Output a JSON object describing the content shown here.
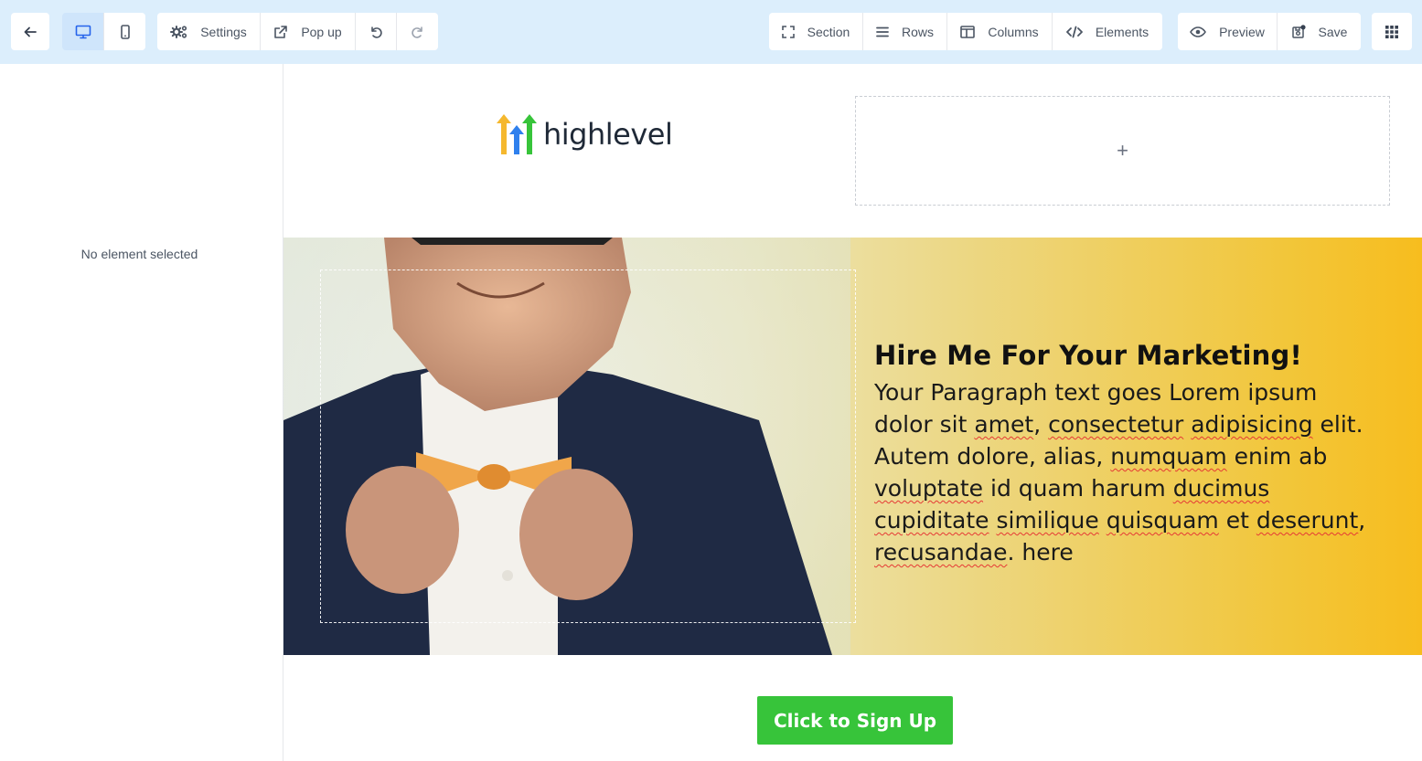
{
  "toolbar": {
    "settings_label": "Settings",
    "popup_label": "Pop up",
    "section_label": "Section",
    "rows_label": "Rows",
    "columns_label": "Columns",
    "elements_label": "Elements",
    "preview_label": "Preview",
    "save_label": "Save"
  },
  "left_panel": {
    "empty_message": "No element selected"
  },
  "canvas": {
    "logo_text": "highlevel",
    "add_placeholder": "+",
    "headline": "Hire Me For Your Marketing!",
    "paragraph": [
      {
        "t": "Your Paragraph text goes Lorem ipsum dolor sit ",
        "u": false
      },
      {
        "t": "amet",
        "u": true
      },
      {
        "t": ", ",
        "u": false
      },
      {
        "t": "consectetur",
        "u": true
      },
      {
        "t": " ",
        "u": false
      },
      {
        "t": "adipisicing",
        "u": true
      },
      {
        "t": " elit. Autem dolore, alias, ",
        "u": false
      },
      {
        "t": "numquam",
        "u": true
      },
      {
        "t": " enim ab ",
        "u": false
      },
      {
        "t": "voluptate",
        "u": true
      },
      {
        "t": " id quam harum ",
        "u": false
      },
      {
        "t": "ducimus",
        "u": true
      },
      {
        "t": " ",
        "u": false
      },
      {
        "t": "cupiditate",
        "u": true
      },
      {
        "t": " ",
        "u": false
      },
      {
        "t": "similique",
        "u": true
      },
      {
        "t": " ",
        "u": false
      },
      {
        "t": "quisquam",
        "u": true
      },
      {
        "t": " et ",
        "u": false
      },
      {
        "t": "deserunt",
        "u": true
      },
      {
        "t": ", ",
        "u": false
      },
      {
        "t": "recusandae",
        "u": true
      },
      {
        "t": ". here",
        "u": false
      }
    ],
    "cta_label": "Click to Sign Up"
  },
  "colors": {
    "toolbar_bg": "#dceefc",
    "cta_green": "#37c43a",
    "hero_yellow": "#f7bd1e",
    "spellcheck_red": "#e53935"
  }
}
